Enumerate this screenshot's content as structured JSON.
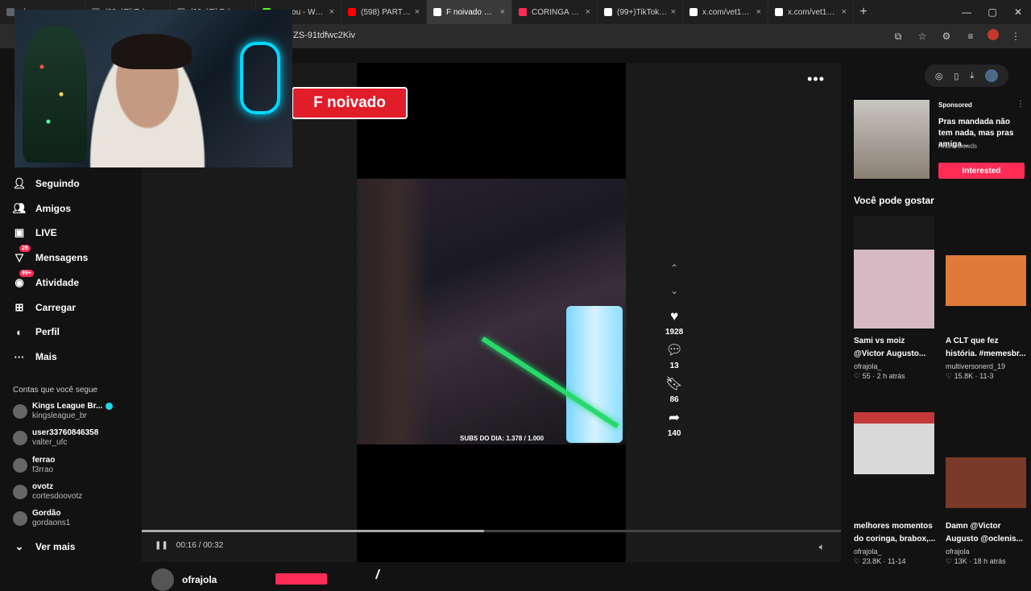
{
  "browser": {
    "tabs": [
      {
        "title": "ela nunca contou",
        "color": "#5f6368",
        "active": false
      },
      {
        "title": "(99+)TikTok - Ma",
        "color": "#5f6368",
        "active": false
      },
      {
        "title": "(99+)TikTok - Ma",
        "color": "#5f6368",
        "active": false
      },
      {
        "title": "purpou - Watch c",
        "color": "#53fc18",
        "active": false
      },
      {
        "title": "(598) PARTIU! OS",
        "color": "#ff0000",
        "active": false
      },
      {
        "title": "F noivado @V",
        "color": "#ffffff",
        "active": true
      },
      {
        "title": "CORINGA FALA S",
        "color": "#fe2c55",
        "active": false
      },
      {
        "title": "(99+)TikTok - Ma",
        "color": "#ffffff",
        "active": false
      },
      {
        "title": "x.com/vet1n_/sta",
        "color": "#ffffff",
        "active": false
      },
      {
        "title": "x.com/vet1n_/sta",
        "color": "#ffffff",
        "active": false
      }
    ],
    "url": "ZS-91tdfwc2Kiv"
  },
  "sidebar": {
    "nav": [
      {
        "label": "Seguindo",
        "icon": "following-icon",
        "badge": ""
      },
      {
        "label": "Amigos",
        "icon": "friends-icon",
        "badge": ""
      },
      {
        "label": "LIVE",
        "icon": "live-icon",
        "badge": ""
      },
      {
        "label": "Mensagens",
        "icon": "messages-icon",
        "badge": "28"
      },
      {
        "label": "Atividade",
        "icon": "activity-icon",
        "badge": "99+"
      },
      {
        "label": "Carregar",
        "icon": "upload-icon",
        "badge": ""
      },
      {
        "label": "Perfil",
        "icon": "profile-icon",
        "badge": ""
      },
      {
        "label": "Mais",
        "icon": "more-icon",
        "badge": ""
      }
    ],
    "following_title": "Contas que você segue",
    "accounts": [
      {
        "name": "Kings League Br...",
        "handle": "kingsleague_br",
        "verified": true
      },
      {
        "name": "user33760846358",
        "handle": "valter_ufc",
        "verified": false
      },
      {
        "name": "ferrao",
        "handle": "f3rrao",
        "verified": false
      },
      {
        "name": "ovotz",
        "handle": "cortesdoovotz",
        "verified": false
      },
      {
        "name": "Gordão",
        "handle": "gordaons1",
        "verified": false
      }
    ],
    "see_more": "Ver mais"
  },
  "video": {
    "caption": "F noivado",
    "subs_text": "SUBS DO DIA: 1.378 / 1.000",
    "likes": "1928",
    "comments": "13",
    "saves": "86",
    "shares": "140",
    "time": "00:16 / 00:32",
    "progress": 0.49,
    "author": "ofrajola"
  },
  "rail": {
    "sponsored": "Sponsored",
    "ad_title": "Pras mandada não tem nada, mas pras amiga...",
    "ad_brand": "André Cowds",
    "interested": "Interested",
    "rec_title": "Você pode gostar",
    "recs": [
      {
        "caption": "Sami vs moiz @Victor Augusto...",
        "author": "ofrajola_",
        "likes": "55",
        "when": "2 h atrás"
      },
      {
        "caption": "A CLT que fez história. #memesbr...",
        "author": "multiversonerd_19",
        "likes": "15.8K",
        "when": "11-3"
      },
      {
        "caption": "melhores momentos do coringa, brabox,...",
        "author": "ofrajola_",
        "likes": "23.8K",
        "when": "11-14"
      },
      {
        "caption": "Damn @Victor Augusto @oclenis...",
        "author": "ofrajola",
        "likes": "13K",
        "when": "18 h atrás"
      }
    ]
  }
}
